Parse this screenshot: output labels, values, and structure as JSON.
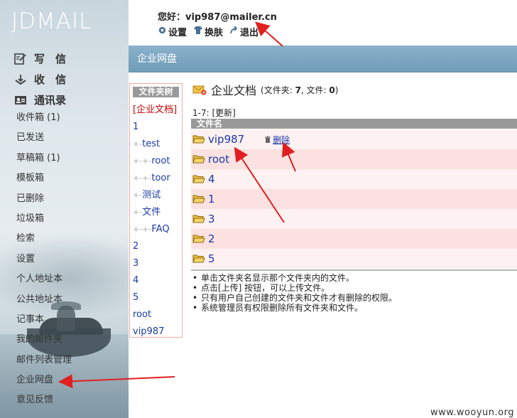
{
  "app": {
    "logo": "JDMAIL"
  },
  "header": {
    "greeting": "您好：vip987@mailer.cn",
    "toolbar": [
      {
        "label": "设置",
        "icon": "gear-icon"
      },
      {
        "label": "换肤",
        "icon": "shirt-icon"
      },
      {
        "label": "退出",
        "icon": "exit-arrow-icon"
      }
    ]
  },
  "sidebar": {
    "main_links": [
      {
        "label": "写　信",
        "icon": "compose-icon"
      },
      {
        "label": "收　信",
        "icon": "inbox-icon"
      },
      {
        "label": "通讯录",
        "icon": "contacts-icon"
      }
    ],
    "folders": [
      "收件箱 (1)",
      "已发送",
      "草稿箱 (1)",
      "模板箱",
      "已删除",
      "垃圾箱",
      "检索",
      "设置",
      "个人地址本",
      "公共地址本",
      "记事本",
      "我的邮件夹",
      "邮件列表管理",
      "企业网盘",
      "意见反馈"
    ]
  },
  "panel": {
    "title": "企业网盘"
  },
  "tree": {
    "title": "文件夹树",
    "items": [
      {
        "prefix": "",
        "label": "[企业文档]",
        "current": true
      },
      {
        "prefix": "",
        "label": "1"
      },
      {
        "prefix": "+-",
        "label": "test"
      },
      {
        "prefix": "+-+-",
        "label": "root"
      },
      {
        "prefix": "+-+-",
        "label": "toor"
      },
      {
        "prefix": "+-",
        "label": "测试"
      },
      {
        "prefix": "+-",
        "label": "文件"
      },
      {
        "prefix": "+-+-",
        "label": "FAQ"
      },
      {
        "prefix": "",
        "label": "2"
      },
      {
        "prefix": "",
        "label": "3"
      },
      {
        "prefix": "",
        "label": "4"
      },
      {
        "prefix": "",
        "label": "5"
      },
      {
        "prefix": "",
        "label": "root"
      },
      {
        "prefix": "",
        "label": "vip987"
      }
    ]
  },
  "content": {
    "title": "企业文档",
    "meta_prefix": "(文件夹: ",
    "folder_count": "7",
    "meta_mid": ", 文件: ",
    "file_count": "0",
    "meta_suffix": ")",
    "range": "1-7: [更新]",
    "column_header": "文件名",
    "delete_label": "删除",
    "rows": [
      "vip987",
      "root",
      "4",
      "1",
      "3",
      "2",
      "5"
    ],
    "notes": [
      "单击文件夹名显示那个文件夹内的文件。",
      "点击[上传] 按钮，可以上传文件。",
      "只有用户自己创建的文件夹和文件才有删除的权限。",
      "系统管理员有权限删除所有文件夹和文件。"
    ]
  },
  "watermark": "www.wooyun.org",
  "colors": {
    "panel_header": "#7aa4c0",
    "row_odd": "#fdf1f1",
    "row_even": "#fce1e1",
    "link": "#1a3aa8",
    "annotation_arrow": "#e02020"
  }
}
